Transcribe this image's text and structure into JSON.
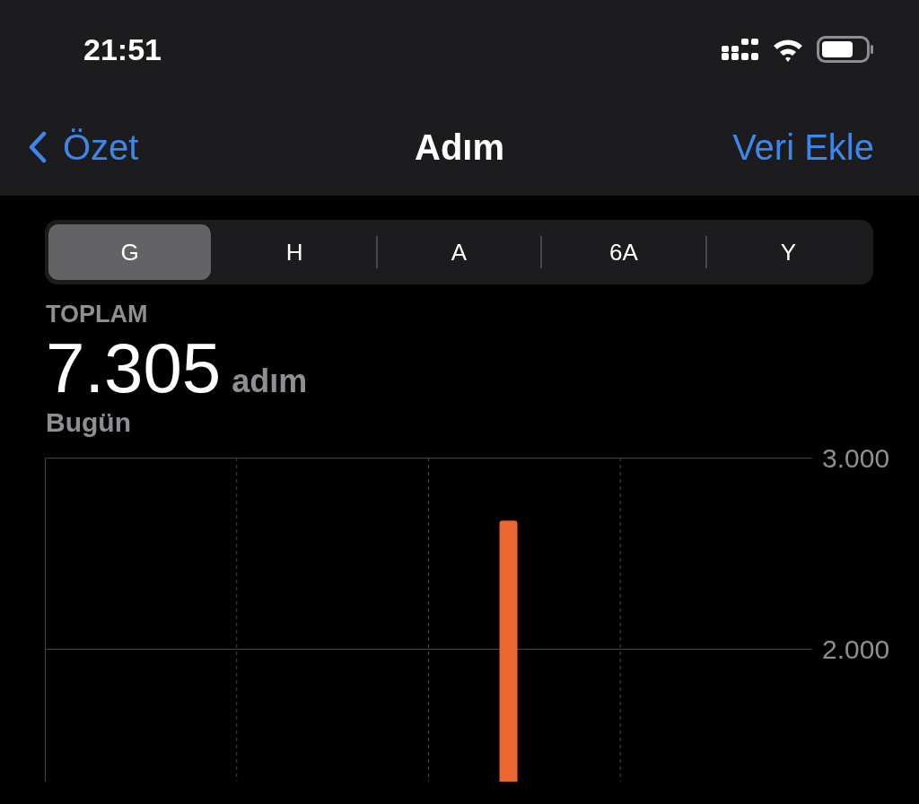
{
  "status_bar": {
    "time": "21:51"
  },
  "nav": {
    "back": "Özet",
    "title": "Adım",
    "action": "Veri Ekle"
  },
  "segments": [
    {
      "label": "G",
      "selected": true
    },
    {
      "label": "H",
      "selected": false
    },
    {
      "label": "A",
      "selected": false
    },
    {
      "label": "6A",
      "selected": false
    },
    {
      "label": "Y",
      "selected": false
    }
  ],
  "summary": {
    "heading": "TOPLAM",
    "value": "7.305",
    "unit": "adım",
    "period": "Bugün"
  },
  "chart_data": {
    "type": "bar",
    "values": [
      null,
      null,
      null,
      null,
      null,
      null,
      null,
      null,
      null,
      null,
      null,
      null,
      null,
      null,
      2670,
      null,
      null,
      null,
      null,
      null,
      null,
      null,
      null,
      null
    ],
    "ylim": [
      0,
      3000
    ],
    "yticks": [
      {
        "value": 2000,
        "label": "2.000"
      },
      {
        "value": 3000,
        "label": "3.000"
      }
    ]
  }
}
